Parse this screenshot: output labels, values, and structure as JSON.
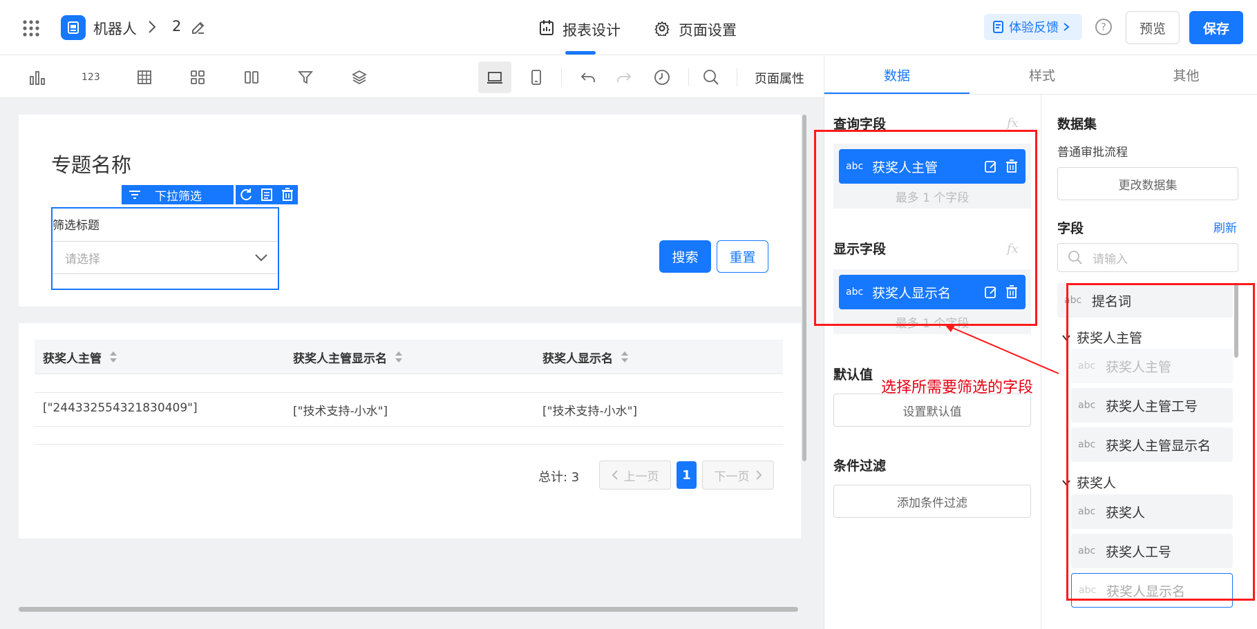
{
  "header": {
    "app_name": "机器人",
    "breadcrumb_sep": ">",
    "page_number": "2",
    "tabs": [
      {
        "label": "报表设计",
        "active": true
      },
      {
        "label": "页面设置",
        "active": false
      }
    ],
    "feedback_label": "体验反馈",
    "help_icon": "?",
    "preview_label": "预览",
    "save_label": "保存",
    "accent": "#1677ff"
  },
  "toolbar": {
    "icons": [
      "bar-chart",
      "number-123",
      "table",
      "grid-cards",
      "columns",
      "filter",
      "layers",
      "desktop",
      "mobile",
      "undo",
      "redo",
      "history",
      "search"
    ],
    "number_label": "123",
    "page_props_label": "页面属性"
  },
  "canvas": {
    "title": "专题名称",
    "filter_widget": {
      "tag_label": "下拉筛选",
      "filter_title": "筛选标题",
      "placeholder": "请选择"
    },
    "search_label": "搜索",
    "reset_label": "重置",
    "table": {
      "columns": [
        "获奖人主管",
        "获奖人主管显示名",
        "获奖人显示名"
      ],
      "rows": [
        [
          "[\"244332554321830409\"]",
          "[\"技术支持-小水\"]",
          "[\"技术支持-小水\"]"
        ]
      ]
    },
    "pagination": {
      "total_label": "总计: 3",
      "prev_label": "上一页",
      "current_page": "1",
      "next_label": "下一页"
    }
  },
  "panel": {
    "tabs": [
      {
        "label": "数据",
        "active": true
      },
      {
        "label": "样式",
        "active": false
      },
      {
        "label": "其他",
        "active": false
      }
    ],
    "query_field": {
      "title": "查询字段",
      "fx": "fx",
      "chip_type": "abc",
      "chip_name": "获奖人主管",
      "hint": "最多 1 个字段"
    },
    "display_field": {
      "title": "显示字段",
      "fx": "fx",
      "chip_type": "abc",
      "chip_name": "获奖人显示名",
      "hint": "最多 1 个字段"
    },
    "default_value": {
      "title": "默认值",
      "button": "设置默认值"
    },
    "condition_filter": {
      "title": "条件过滤",
      "button": "添加条件过滤"
    },
    "annotation": "选择所需要筛选的字段"
  },
  "dataset_panel": {
    "title": "数据集",
    "dataset_name": "普通审批流程",
    "change_button": "更改数据集",
    "fields_title": "字段",
    "refresh_label": "刷新",
    "search_placeholder": "请输入",
    "top_field": {
      "type": "abc",
      "name": "提名词"
    },
    "groups": [
      {
        "name": "获奖人主管",
        "items": [
          {
            "type": "abc",
            "name": "获奖人主管",
            "state": "disabled"
          },
          {
            "type": "abc",
            "name": "获奖人主管工号",
            "state": "normal"
          },
          {
            "type": "abc",
            "name": "获奖人主管显示名",
            "state": "normal"
          }
        ]
      },
      {
        "name": "获奖人",
        "items": [
          {
            "type": "abc",
            "name": "获奖人",
            "state": "normal"
          },
          {
            "type": "abc",
            "name": "获奖人工号",
            "state": "normal"
          },
          {
            "type": "abc",
            "name": "获奖人显示名",
            "state": "selected"
          }
        ]
      }
    ]
  }
}
